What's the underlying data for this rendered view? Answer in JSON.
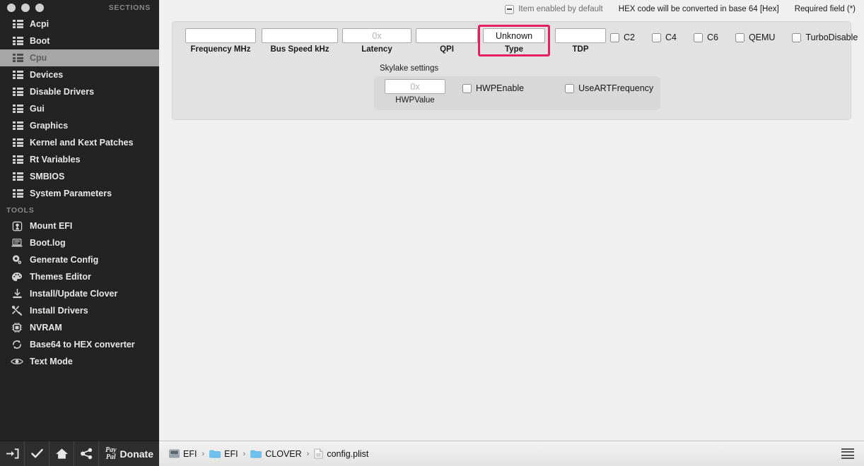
{
  "window": {
    "traffic_lights": [
      "close",
      "minimize",
      "zoom"
    ]
  },
  "sidebar": {
    "sections_header": "SECTIONS",
    "tools_header": "TOOLS",
    "sections": [
      {
        "label": "Acpi",
        "icon": "list-icon",
        "selected": false
      },
      {
        "label": "Boot",
        "icon": "list-icon",
        "selected": false
      },
      {
        "label": "Cpu",
        "icon": "list-icon",
        "selected": true
      },
      {
        "label": "Devices",
        "icon": "list-icon",
        "selected": false
      },
      {
        "label": "Disable Drivers",
        "icon": "list-icon",
        "selected": false
      },
      {
        "label": "Gui",
        "icon": "list-icon",
        "selected": false
      },
      {
        "label": "Graphics",
        "icon": "list-icon",
        "selected": false
      },
      {
        "label": "Kernel and Kext Patches",
        "icon": "list-icon",
        "selected": false
      },
      {
        "label": "Rt Variables",
        "icon": "list-icon",
        "selected": false
      },
      {
        "label": "SMBIOS",
        "icon": "list-icon",
        "selected": false
      },
      {
        "label": "System Parameters",
        "icon": "list-icon",
        "selected": false
      }
    ],
    "tools": [
      {
        "label": "Mount EFI",
        "icon": "mount-efi-icon"
      },
      {
        "label": "Boot.log",
        "icon": "laptop-icon"
      },
      {
        "label": "Generate Config",
        "icon": "gear-icon"
      },
      {
        "label": "Themes Editor",
        "icon": "palette-icon"
      },
      {
        "label": "Install/Update Clover",
        "icon": "download-icon"
      },
      {
        "label": "Install Drivers",
        "icon": "tools-icon"
      },
      {
        "label": "NVRAM",
        "icon": "chip-icon"
      },
      {
        "label": "Base64 to HEX converter",
        "icon": "refresh-icon"
      },
      {
        "label": "Text Mode",
        "icon": "eye-icon"
      }
    ]
  },
  "legend": {
    "item_enabled_by_default": "Item enabled by default",
    "hex_note": "HEX code will be converted in base 64 [Hex]",
    "required_field": "Required field (*)"
  },
  "cpu_panel": {
    "fields": [
      {
        "name": "frequency",
        "label": "Frequency MHz",
        "value": "",
        "placeholder": ""
      },
      {
        "name": "bus-speed",
        "label": "Bus Speed kHz",
        "value": "",
        "placeholder": ""
      },
      {
        "name": "latency",
        "label": "Latency",
        "value": "",
        "placeholder": "0x"
      },
      {
        "name": "qpi",
        "label": "QPI",
        "value": "",
        "placeholder": ""
      },
      {
        "name": "type",
        "label": "Type",
        "value": "Unknown",
        "placeholder": ""
      },
      {
        "name": "tdp",
        "label": "TDP",
        "value": "",
        "placeholder": ""
      }
    ],
    "checkboxes": [
      {
        "label": "C2",
        "checked": false
      },
      {
        "label": "C4",
        "checked": false
      },
      {
        "label": "C6",
        "checked": false
      },
      {
        "label": "QEMU",
        "checked": false
      },
      {
        "label": "TurboDisable",
        "checked": false
      }
    ],
    "skylake": {
      "title": "Skylake settings",
      "hwp_value": {
        "label": "HWPValue",
        "value": "",
        "placeholder": "0x"
      },
      "checkboxes": [
        {
          "label": "HWPEnable",
          "checked": false
        },
        {
          "label": "UseARTFrequency",
          "checked": false
        }
      ]
    },
    "highlight_color": "#e51e63",
    "highlighted_field": "Type"
  },
  "bottom_bar": {
    "buttons": [
      {
        "name": "export-icon",
        "label": ""
      },
      {
        "name": "check-icon",
        "label": ""
      },
      {
        "name": "home-icon",
        "label": ""
      },
      {
        "name": "share-icon",
        "label": ""
      }
    ],
    "paypal_line1": "Pay",
    "paypal_line2": "Pal",
    "donate_label": "Donate",
    "breadcrumb": [
      {
        "label": "EFI",
        "icon": "disk-icon"
      },
      {
        "label": "EFI",
        "icon": "folder-icon"
      },
      {
        "label": "CLOVER",
        "icon": "folder-icon"
      },
      {
        "label": "config.plist",
        "icon": "document-icon"
      }
    ],
    "separator": "›",
    "menu_icon": "hamburger-icon"
  }
}
